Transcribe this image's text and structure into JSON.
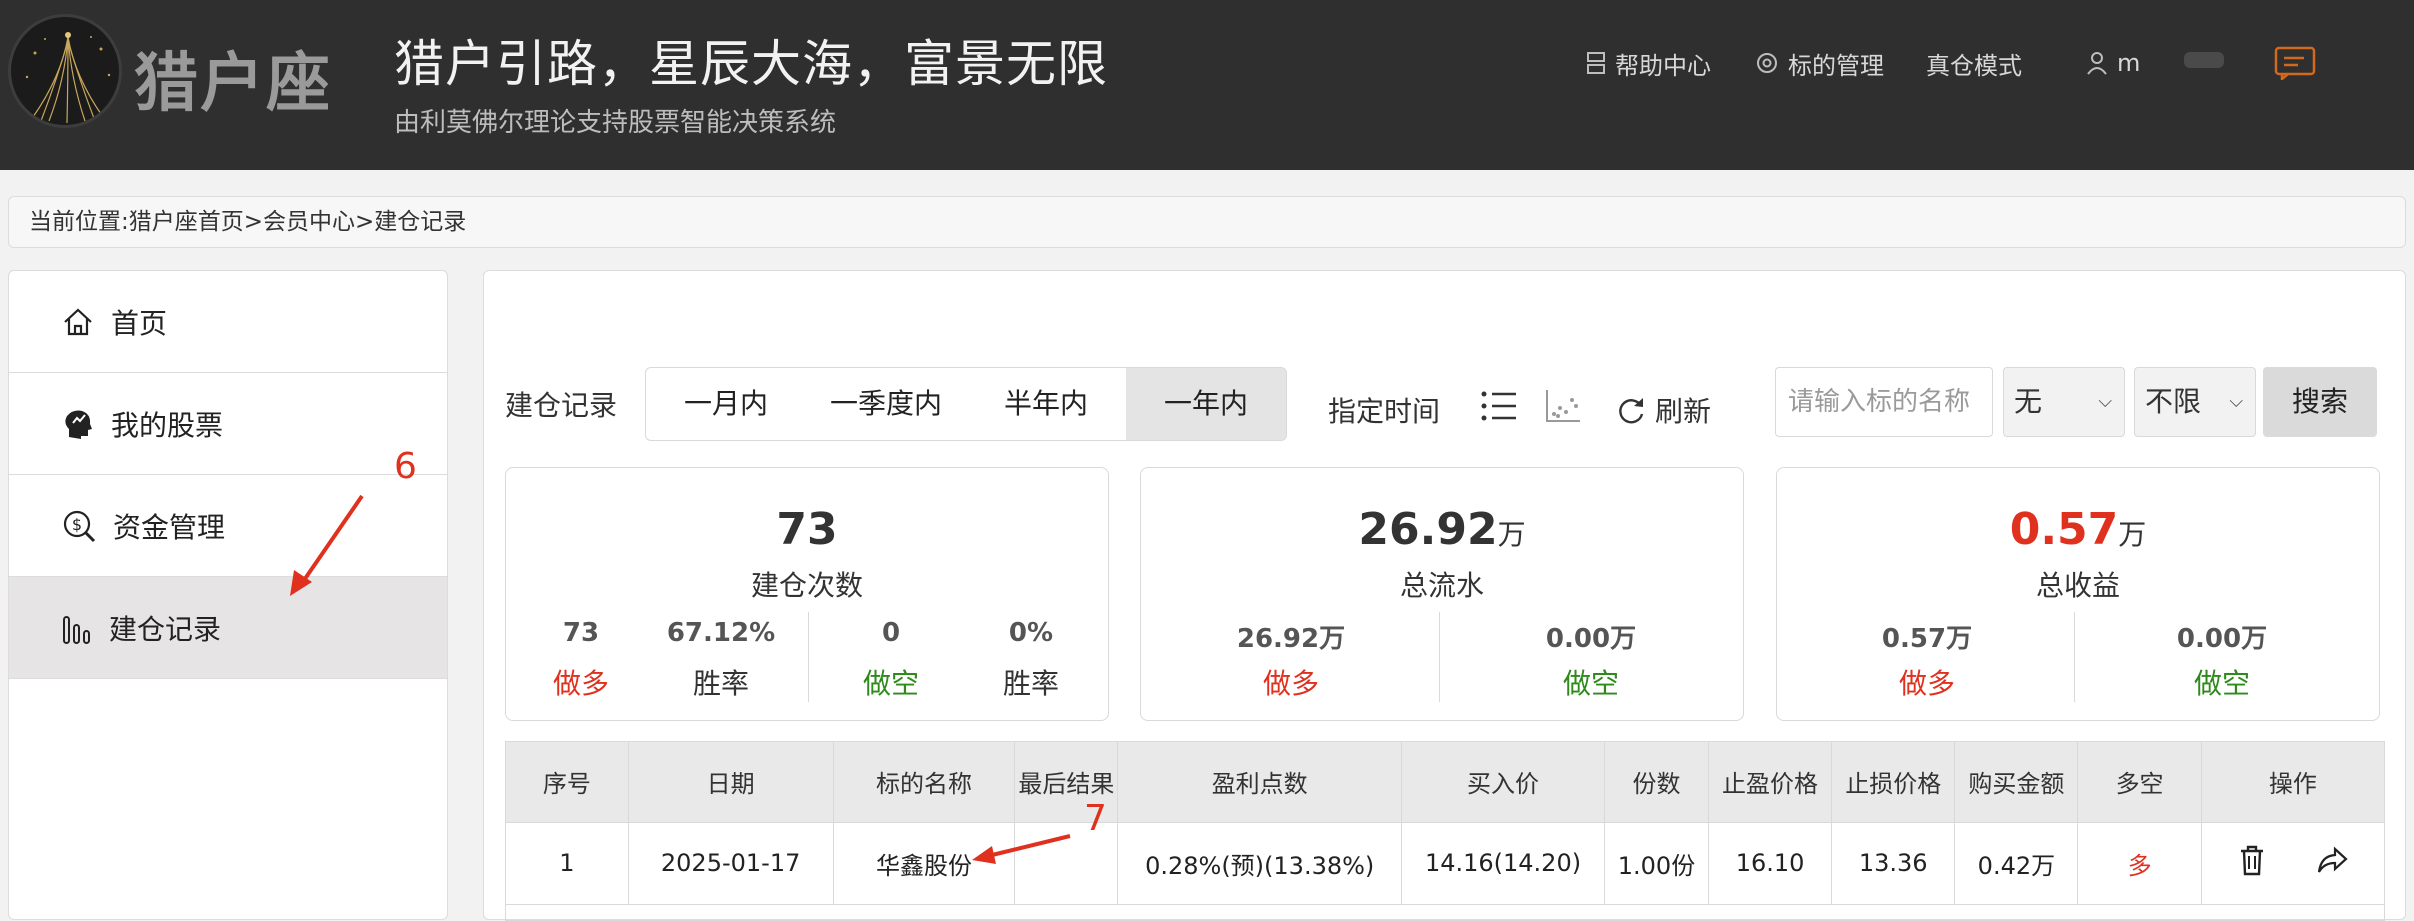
{
  "header": {
    "brand": "猎户座",
    "slogan": "猎户引路，星辰大海，富景无限",
    "subslogan": "由利莫佛尔理论支持股票智能决策系统",
    "nav": {
      "help": "帮助中心",
      "target_mgmt": "标的管理",
      "real_mode": "真仓模式",
      "user": "m"
    }
  },
  "breadcrumb": "当前位置:猎户座首页>会员中心>建仓记录",
  "sidebar": {
    "items": [
      {
        "label": "首页",
        "icon": "home-icon"
      },
      {
        "label": "我的股票",
        "icon": "stock-head-icon"
      },
      {
        "label": "资金管理",
        "icon": "money-search-icon"
      },
      {
        "label": "建仓记录",
        "icon": "bar-chart-icon",
        "active": true
      }
    ]
  },
  "annotations": {
    "a6": "6",
    "a7": "7"
  },
  "filters": {
    "label": "建仓记录",
    "periods": [
      "一月内",
      "一季度内",
      "半年内",
      "一年内"
    ],
    "active_period": "一年内",
    "specify_time": "指定时间",
    "refresh": "刷新",
    "search_placeholder": "请输入标的名称",
    "select1": "无",
    "select2": "不限",
    "search_button": "搜索"
  },
  "stats": {
    "count": {
      "value": "73",
      "caption": "建仓次数",
      "long_value": "73",
      "long_label": "做多",
      "long_rate": "67.12%",
      "rate_label": "胜率",
      "short_value": "0",
      "short_label": "做空",
      "short_rate": "0%",
      "short_rate_label": "胜率"
    },
    "flow": {
      "value": "26.92",
      "unit": "万",
      "caption": "总流水",
      "long_value": "26.92万",
      "long_label": "做多",
      "short_value": "0.00万",
      "short_label": "做空"
    },
    "profit": {
      "value": "0.57",
      "unit": "万",
      "caption": "总收益",
      "long_value": "0.57万",
      "long_label": "做多",
      "short_value": "0.00万",
      "short_label": "做空"
    }
  },
  "table": {
    "headers": [
      "序号",
      "日期",
      "标的名称",
      "最后结果",
      "盈利点数",
      "买入价",
      "份数",
      "止盈价格",
      "止损价格",
      "购买金额",
      "多空",
      "操作"
    ],
    "rows": [
      {
        "no": "1",
        "date": "2025-01-17",
        "name": "华鑫股份",
        "result": "",
        "profit_points": "0.28%(预)(13.38%)",
        "buy_price": "14.16(14.20)",
        "shares": "1.00份",
        "take_profit": "16.10",
        "stop_loss": "13.36",
        "amount": "0.42万",
        "direction": "多"
      }
    ]
  },
  "colors": {
    "header_bg": "#2f2f2f",
    "red": "#e0301e",
    "green": "#2f8a1c",
    "active_bg": "#e6e4e4"
  }
}
